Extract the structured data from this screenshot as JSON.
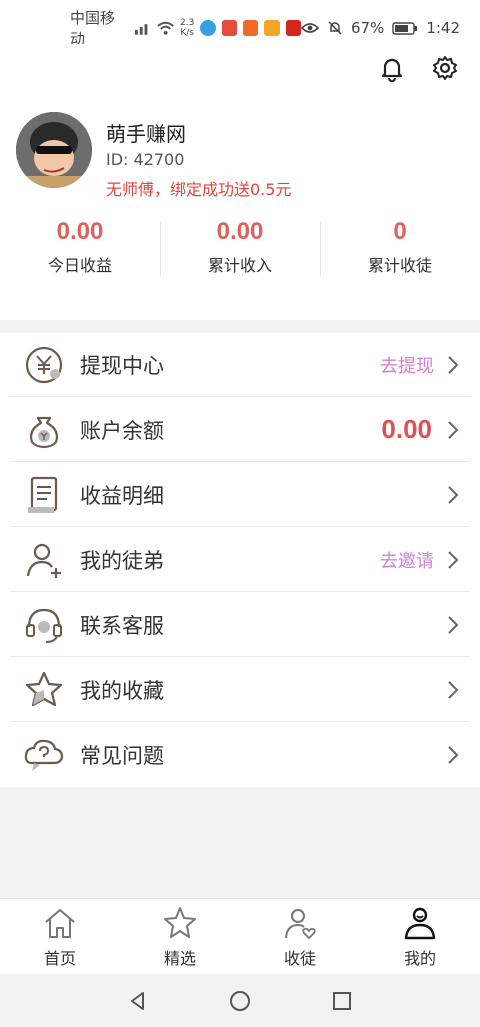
{
  "status_bar": {
    "carrier": "中国移动",
    "net_speed_value": "2.3",
    "net_speed_unit": "K/s",
    "battery": "67%",
    "time": "1:42"
  },
  "profile": {
    "name": "萌手赚网",
    "id_text": "ID: 42700",
    "hint": "无师傅，绑定成功送0.5元"
  },
  "stats": [
    {
      "value": "0.00",
      "label": "今日收益"
    },
    {
      "value": "0.00",
      "label": "累计收入"
    },
    {
      "value": "0",
      "label": "累计收徒"
    }
  ],
  "menu": [
    {
      "label": "提现中心",
      "extra": "去提现"
    },
    {
      "label": "账户余额",
      "balance": "0.00"
    },
    {
      "label": "收益明细"
    },
    {
      "label": "我的徒弟",
      "extra": "去邀请"
    },
    {
      "label": "联系客服"
    },
    {
      "label": "我的收藏"
    },
    {
      "label": "常见问题"
    }
  ],
  "tabs": [
    {
      "label": "首页"
    },
    {
      "label": "精选"
    },
    {
      "label": "收徒"
    },
    {
      "label": "我的"
    }
  ],
  "colors": {
    "accent_red": "#e06060",
    "link_purple": "#d183d8",
    "icon_brown": "#6b5a52"
  }
}
